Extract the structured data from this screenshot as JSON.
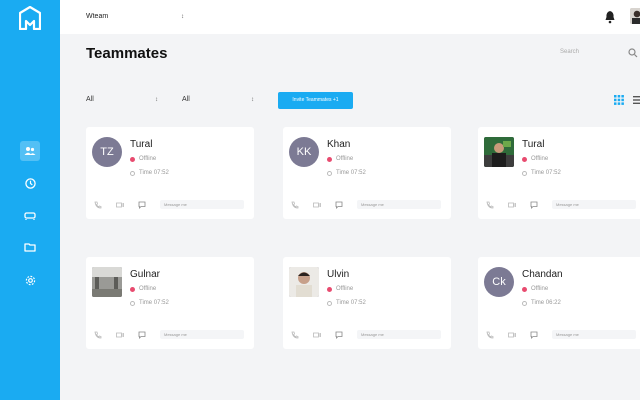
{
  "topbar": {
    "workspace": "Wteam"
  },
  "header": {
    "title": "Teammates",
    "search_placeholder": "Search"
  },
  "filters": [
    {
      "value": "All"
    },
    {
      "value": "All"
    }
  ],
  "invite_button": "Invite Teammates +1",
  "colors": {
    "sidebar": "#1aabf2",
    "accent": "#1aabf2",
    "status_offline": "#e84b6f",
    "avatar_bg": "#7c7a94"
  },
  "teammates": [
    {
      "initials": "TZ",
      "name": "Tural",
      "status": "Offline",
      "time": "Time 07:52",
      "message_placeholder": "Message me"
    },
    {
      "initials": "KK",
      "name": "Khan",
      "status": "Offline",
      "time": "Time 07:52",
      "message_placeholder": "Message me"
    },
    {
      "initials": "",
      "name": "Tural",
      "status": "Offline",
      "time": "Time 07:52",
      "message_placeholder": "Message me"
    },
    {
      "initials": "",
      "name": "Gulnar",
      "status": "Offline",
      "time": "Time 07:52",
      "message_placeholder": "Message me"
    },
    {
      "initials": "",
      "name": "Ulvin",
      "status": "Offline",
      "time": "Time 07:52",
      "message_placeholder": "Message me"
    },
    {
      "initials": "Ck",
      "name": "Chandan",
      "status": "Offline",
      "time": "Time 06:22",
      "message_placeholder": "Message me"
    }
  ]
}
